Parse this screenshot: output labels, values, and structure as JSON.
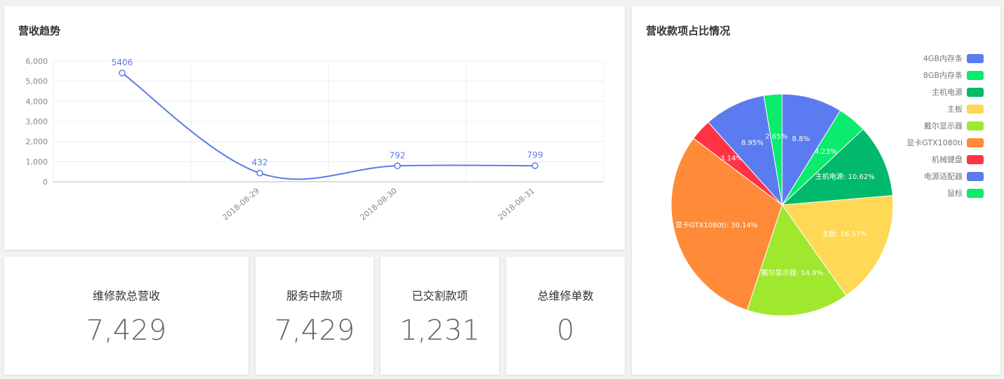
{
  "line_card": {
    "title": "营收趋势"
  },
  "pie_card": {
    "title": "营收款项占比情况"
  },
  "stats": [
    {
      "label": "维修款总营收",
      "value": "7,429"
    },
    {
      "label": "服务中款项",
      "value": "7,429"
    },
    {
      "label": "已交割款项",
      "value": "1,231"
    },
    {
      "label": "总维修单数",
      "value": "0"
    }
  ],
  "chart_data": [
    {
      "type": "line",
      "categories": [
        "",
        "2018-08-29",
        "2018-08-30",
        "2018-08-31"
      ],
      "series": [
        {
          "values": [
            5406,
            432,
            792,
            799
          ],
          "color": "#5b7bec"
        }
      ],
      "data_labels": [
        "5406",
        "432",
        "792",
        "799"
      ],
      "ylim": [
        0,
        6000
      ],
      "y_ticks": [
        "0",
        "1,000",
        "2,000",
        "3,000",
        "4,000",
        "5,000",
        "6,000"
      ],
      "grid": true,
      "title": "营收趋势"
    },
    {
      "type": "pie",
      "title": "营收款项占比情况",
      "legend_position": "top-right",
      "slices": [
        {
          "name": "4GB内存条",
          "value": 8.8,
          "label": "8.8%",
          "color": "#5b7bf0"
        },
        {
          "name": "8GB内存条",
          "value": 4.23,
          "label": "4.23%",
          "color": "#0beb6d"
        },
        {
          "name": "主机电源",
          "value": 10.62,
          "label": "主机电源: 10.62%",
          "color": "#00b96b"
        },
        {
          "name": "主板",
          "value": 16.57,
          "label": "主板: 16.57%",
          "color": "#ffd855"
        },
        {
          "name": "戴尔显示器",
          "value": 14.9,
          "label": "戴尔显示器: 14.9%",
          "color": "#a0e82e"
        },
        {
          "name": "显卡GTX1080ti",
          "value": 30.14,
          "label": "显卡GTX1080ti: 30.14%",
          "color": "#ff8b38"
        },
        {
          "name": "机械键盘",
          "value": 3.14,
          "label": "3.14%",
          "color": "#ff3344"
        },
        {
          "name": "电源适配器",
          "value": 8.95,
          "label": "8.95%",
          "color": "#5b7bf0"
        },
        {
          "name": "鼠标",
          "value": 2.65,
          "label": "2.65%",
          "color": "#0beb6d"
        }
      ]
    }
  ]
}
